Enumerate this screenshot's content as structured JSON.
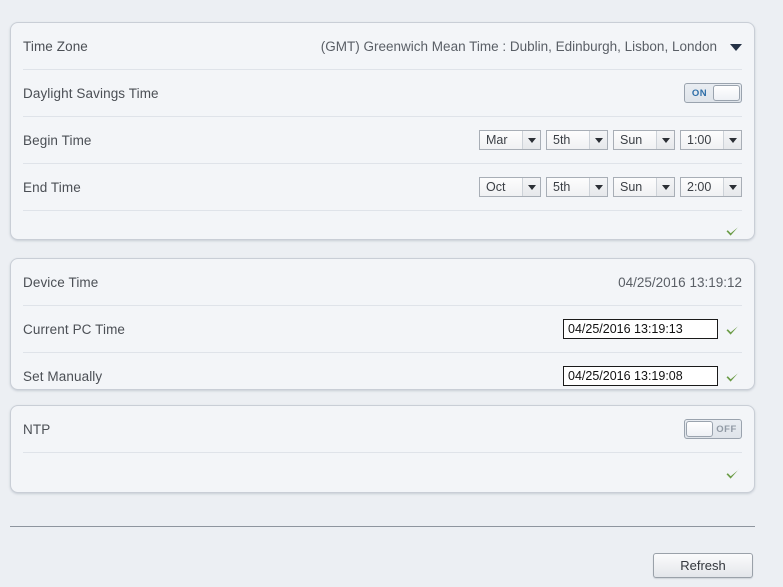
{
  "panels": {
    "timezone": {
      "rows": [
        {
          "label": "Time Zone",
          "value": "(GMT) Greenwich Mean Time : Dublin, Edinburgh, Lisbon, London",
          "icon": "chevron-down-icon"
        },
        {
          "label": "Daylight Savings Time",
          "toggle_state": "ON"
        },
        {
          "label": "Begin Time",
          "selects": [
            {
              "name": "month",
              "value": "Mar"
            },
            {
              "name": "day",
              "value": "5th"
            },
            {
              "name": "weekday",
              "value": "Sun"
            },
            {
              "name": "hour",
              "value": "1:00"
            }
          ]
        },
        {
          "label": "End Time",
          "selects": [
            {
              "name": "month",
              "value": "Oct"
            },
            {
              "name": "day",
              "value": "5th"
            },
            {
              "name": "weekday",
              "value": "Sun"
            },
            {
              "name": "hour",
              "value": "2:00"
            }
          ]
        }
      ],
      "apply_icon": "green-check-icon"
    },
    "device_time": {
      "rows": [
        {
          "label": "Device Time",
          "value": "04/25/2016 13:19:12"
        },
        {
          "label": "Current PC Time",
          "input_value": "04/25/2016 13:19:13",
          "icon": "green-check-icon"
        },
        {
          "label": "Set Manually",
          "input_value": "04/25/2016 13:19:08",
          "icon": "green-check-icon"
        }
      ]
    },
    "ntp": {
      "label": "NTP",
      "toggle_state": "OFF",
      "apply_icon": "green-check-icon"
    }
  },
  "footer": {
    "refresh_label": "Refresh"
  },
  "colors": {
    "page_background": "#eceff3",
    "panel_background": "#f3f5f8",
    "panel_border": "#c9ced6",
    "label_text": "#4b4f55",
    "check_green": "#6a9b45",
    "toggle_on_text": "#2f6fa8",
    "toggle_off_text": "#9099a4"
  }
}
